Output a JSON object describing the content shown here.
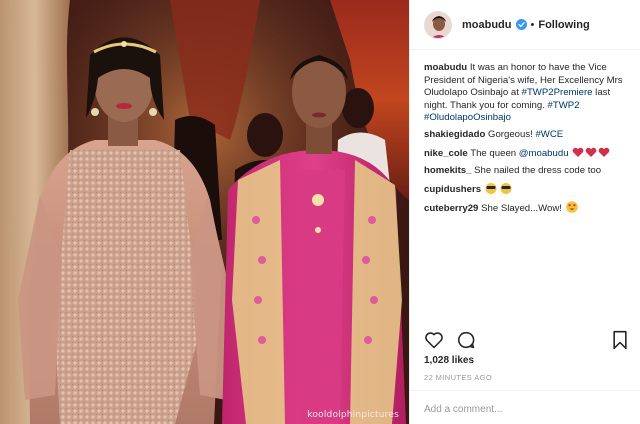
{
  "post": {
    "username": "moabudu",
    "follow_state": "Following",
    "separator": "•",
    "photo_credit": "kooldolphinpictures",
    "caption": {
      "user": "moabudu",
      "text_1": "It was an honor to have the Vice President of Nigeria's wife, Her Excellency Mrs Oludolapo Osinbajo at ",
      "tag_1": "#TWP2Premiere",
      "text_2": " last night. Thank you for coming. ",
      "tag_2": "#TWP2",
      "tag_3": "#OludolapoOsinbajo"
    },
    "comments": [
      {
        "user": "shakiegidado",
        "text": "Gorgeous! ",
        "tag": "#WCE",
        "emoji": ""
      },
      {
        "user": "nike_cole",
        "text": "The queen ",
        "tag": "@moabudu",
        "emoji": "hearts"
      },
      {
        "user": "homekits_",
        "text": "She nailed the dress code too",
        "tag": "",
        "emoji": ""
      },
      {
        "user": "cupidushers",
        "text": "",
        "tag": "",
        "emoji": "sunglasses"
      },
      {
        "user": "cuteberry29",
        "text": "She Slayed...Wow!",
        "tag": "",
        "emoji": "heart-eyes"
      }
    ],
    "likes": "1,028 likes",
    "timestamp": "22 MINUTES AGO",
    "add_comment_placeholder": "Add a comment...",
    "icons": {
      "like": "heart-outline-icon",
      "comment": "speech-bubble-icon",
      "save": "bookmark-icon",
      "verified": "verified-badge-icon"
    },
    "colors": {
      "link": "#003569",
      "verified": "#3897f0",
      "heart_emoji": "#d0304a",
      "divider": "#efefef",
      "muted": "#999999"
    }
  }
}
